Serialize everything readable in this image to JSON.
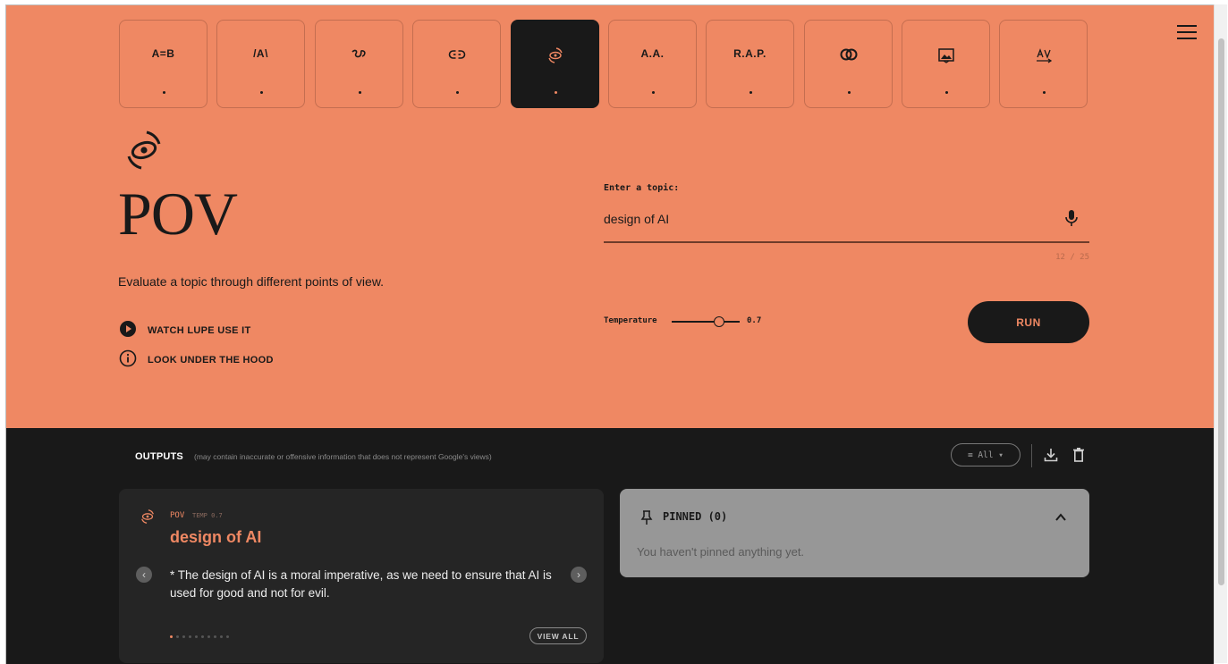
{
  "tools": [
    {
      "glyph": "A=B",
      "icon": "equivalence-icon"
    },
    {
      "glyph": "/A\\",
      "icon": "expand-icon"
    },
    {
      "glyph": "",
      "icon": "scribble-icon"
    },
    {
      "glyph": "",
      "icon": "link-icon"
    },
    {
      "glyph": "",
      "icon": "eye-rotate-icon",
      "active": true
    },
    {
      "glyph": "A.A.",
      "icon": "acronym-icon"
    },
    {
      "glyph": "R.A.P.",
      "icon": "acronym-rap-icon"
    },
    {
      "glyph": "",
      "icon": "overlap-circles-icon"
    },
    {
      "glyph": "",
      "icon": "image-icon"
    },
    {
      "glyph": "",
      "icon": "unscramble-icon"
    }
  ],
  "tool": {
    "icon": "eye-rotate-icon",
    "title": "POV",
    "description": "Evaluate a topic through different points of view.",
    "links": [
      {
        "label": "WATCH LUPE USE IT",
        "icon": "play-circle-icon"
      },
      {
        "label": "LOOK UNDER THE HOOD",
        "icon": "info-circle-icon"
      }
    ]
  },
  "form": {
    "topic_label": "Enter a topic:",
    "topic_value": "design of AI",
    "counter": "12 / 25",
    "temperature_label": "Temperature",
    "temperature_value": "0.7",
    "temperature": 0.7,
    "run_label": "RUN"
  },
  "outputs": {
    "title": "OUTPUTS",
    "note": "(may contain inaccurate or offensive information that does not represent Google's views)",
    "filter_label": "≡ All ▾",
    "card": {
      "tag": "POV",
      "temp": "TEMP 0.7",
      "title": "design of AI",
      "text": "* The design of AI is a moral imperative, as we need to ensure that AI is used for good and not for evil.",
      "view_all_label": "VIEW ALL",
      "page_count": 10,
      "current_page": 1
    },
    "pinned": {
      "title": "PINNED (0)",
      "empty_text": "You haven't pinned anything yet."
    }
  },
  "colors": {
    "accent": "#ef8863",
    "dark": "#191919",
    "card": "#252525",
    "pinned": "#979797"
  }
}
